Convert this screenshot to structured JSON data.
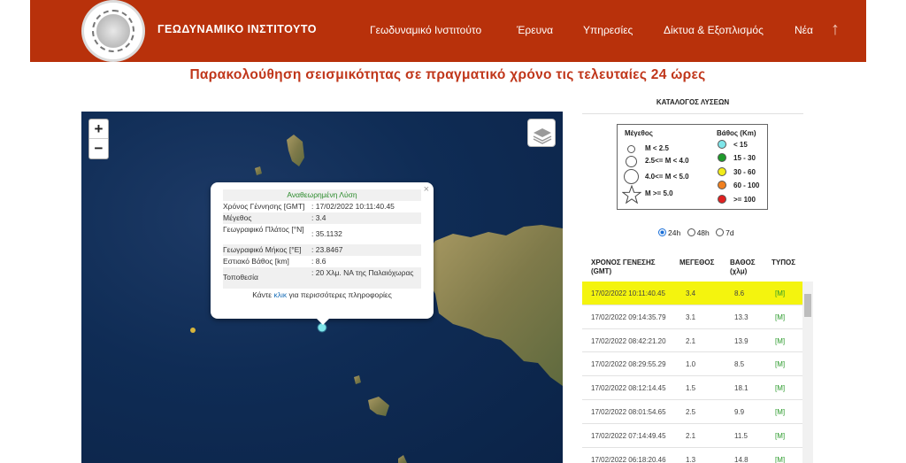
{
  "header": {
    "brand": "ΓΕΩΔΥΝΑΜΙΚΟ ΙΝΣΤΙΤΟΥΤΟ",
    "nav": [
      "Γεωδυναμικό Ινστιτούτο",
      "Έρευνα",
      "Υπηρεσίες",
      "Δίκτυα & Εξοπλισμός",
      "Νέα"
    ],
    "up_arrow": "↑",
    "color": "#b8310b"
  },
  "page_title": "Παρακολούθηση σεισμικότητας σε πραγματικό χρόνο τις τελευταίες 24 ώρες",
  "map": {
    "zoom_in": "+",
    "zoom_out": "−",
    "popup": {
      "title": "Αναθεωρημένη Λύση",
      "rows": [
        {
          "label": "Χρόνος Γέννησης [GMT]",
          "value": ": 17/02/2022 10:11:40.45"
        },
        {
          "label": "Μέγεθος",
          "value": ": 3.4"
        },
        {
          "label": "Γεωγραφικό Πλάτος [°N]",
          "value": ": 35.1132"
        },
        {
          "label": "Γεωγραφικό Μήκος [°E]",
          "value": ": 23.8467"
        },
        {
          "label": "Εστιακό Βάθος [km]",
          "value": ": 8.6"
        },
        {
          "label": "Τοποθεσία",
          "value": ": 20 Χλμ. ΝΑ της Παλαιόχωρας"
        }
      ],
      "footer_pre": "Κάντε ",
      "footer_link": "κλικ",
      "footer_post": " για περισσότερες πληροφορίες",
      "close": "×"
    }
  },
  "catalog": {
    "heading": "ΚΑΤΑΛΟΓΟΣ ΛΥΣΕΩΝ",
    "legend": {
      "mag_title": "Μέγεθος",
      "mag_items": [
        "M < 2.5",
        "2.5<= M < 4.0",
        "4.0<= M < 5.0",
        "M >= 5.0"
      ],
      "depth_title": "Βάθος (Km)",
      "depth_items": [
        {
          "label": "< 15",
          "color": "#7fe6ea"
        },
        {
          "label": "15 - 30",
          "color": "#1e9a2a"
        },
        {
          "label": "30 - 60",
          "color": "#f2ec1a"
        },
        {
          "label": "60 - 100",
          "color": "#f08020"
        },
        {
          "label": ">= 100",
          "color": "#e02020"
        }
      ]
    },
    "periods": [
      "24h",
      "48h",
      "7d"
    ],
    "selected_period": "24h",
    "columns": [
      "ΧΡΟΝΟΣ ΓΕΝΕΣΗΣ (GMT)",
      "ΜΕΓΕΘΟΣ",
      "ΒΑΘΟΣ (χλμ)",
      "ΤΥΠΟΣ"
    ],
    "rows": [
      {
        "time": "17/02/2022 10:11:40.45",
        "mag": "3.4",
        "depth": "8.6",
        "type": "[M]",
        "selected": true
      },
      {
        "time": "17/02/2022 09:14:35.79",
        "mag": "3.1",
        "depth": "13.3",
        "type": "[M]"
      },
      {
        "time": "17/02/2022 08:42:21.20",
        "mag": "2.1",
        "depth": "13.9",
        "type": "[M]"
      },
      {
        "time": "17/02/2022 08:29:55.29",
        "mag": "1.0",
        "depth": "8.5",
        "type": "[M]"
      },
      {
        "time": "17/02/2022 08:12:14.45",
        "mag": "1.5",
        "depth": "18.1",
        "type": "[M]"
      },
      {
        "time": "17/02/2022 08:01:54.65",
        "mag": "2.5",
        "depth": "9.9",
        "type": "[M]"
      },
      {
        "time": "17/02/2022 07:14:49.45",
        "mag": "2.1",
        "depth": "11.5",
        "type": "[M]"
      },
      {
        "time": "17/02/2022 06:18:20.46",
        "mag": "1.3",
        "depth": "14.8",
        "type": "[M]"
      }
    ]
  }
}
